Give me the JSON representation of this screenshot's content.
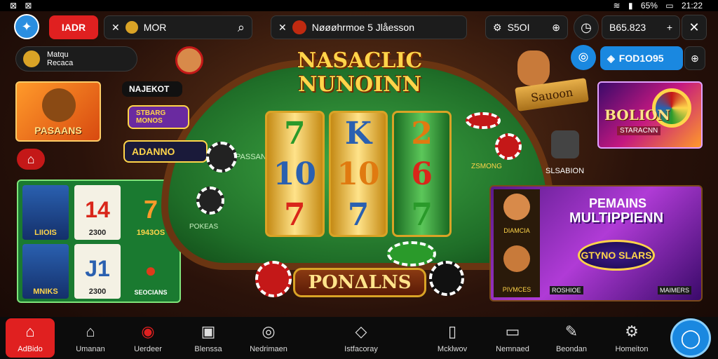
{
  "status": {
    "left_icons": [
      "⊠",
      "⊠"
    ],
    "battery": "65%",
    "time": "21:22"
  },
  "topbar": {
    "logo_icon": "star-icon",
    "badge_label": "IADR",
    "search_prefix": "MOR",
    "notice_text": "Nøøøhrmoe 5 Jlåesson",
    "balance1": "S5OI",
    "balance2": "B65.823"
  },
  "left": {
    "account_line1": "Matqu",
    "account_line2": "Recaca",
    "feature_tile_label": "PASAANS",
    "home_label": "⌂"
  },
  "table": {
    "title_line1": "NASACLIC",
    "title_line2": "NUNOINN",
    "banner_label": "NAJEKOT",
    "tag1_label": "STBARG MONOS",
    "tag2_label": "ADANNO",
    "felt_text1": "PASSAN",
    "felt_text2": "ZSMONG",
    "felt_text3": "POKEAS",
    "reel1": [
      "7",
      "10",
      "7"
    ],
    "reel2": [
      "K",
      "10",
      "7"
    ],
    "reel3": [
      "2",
      "6",
      "7"
    ],
    "bonus_button": "PONΔLNS",
    "scroll_label": "Sauoon",
    "mask_label": "SLSABION"
  },
  "right": {
    "pill_icon_label": "⦾",
    "pill_label": "FOD1O95",
    "promo1_label": "BOLION",
    "promo1_sub": "STARACNN",
    "promo2_title1": "PEMAINS",
    "promo2_title2": "MULTIPPIENN",
    "promo2_center": "GTYNO SLARS",
    "promo2_left_labels": [
      "DIAMCIA",
      "PIVMCES"
    ],
    "promo2_bottom_labels": [
      "ROSHIOE",
      "MAIMERS"
    ]
  },
  "grid": [
    {
      "text": "LIIOIS"
    },
    {
      "text": "2300",
      "value": "14"
    },
    {
      "text": "1943OS",
      "value": "7"
    },
    {
      "text": "MNIKS"
    },
    {
      "text": "2300",
      "value": "J1"
    },
    {
      "text": "SEOCIANS"
    }
  ],
  "nav": [
    {
      "icon": "home-icon",
      "glyph": "⌂",
      "label": "AdBido"
    },
    {
      "icon": "house-icon",
      "glyph": "⌂",
      "label": "Umanan"
    },
    {
      "icon": "chip-icon",
      "glyph": "◉",
      "label": "Uerdeer"
    },
    {
      "icon": "card-icon",
      "glyph": "▣",
      "label": "Blenssa"
    },
    {
      "icon": "medal-icon",
      "glyph": "◎",
      "label": "Nedrimaen"
    },
    {
      "icon": "diamond-icon",
      "glyph": "◇",
      "label": "Istfacoray"
    },
    {
      "icon": "tablet-icon",
      "glyph": "▯",
      "label": "Mcklwov"
    },
    {
      "icon": "screen-icon",
      "glyph": "▭",
      "label": "Nemnaed"
    },
    {
      "icon": "tool-icon",
      "glyph": "✎",
      "label": "Beondan"
    },
    {
      "icon": "gear-icon",
      "glyph": "⚙",
      "label": "Homeiton"
    }
  ]
}
